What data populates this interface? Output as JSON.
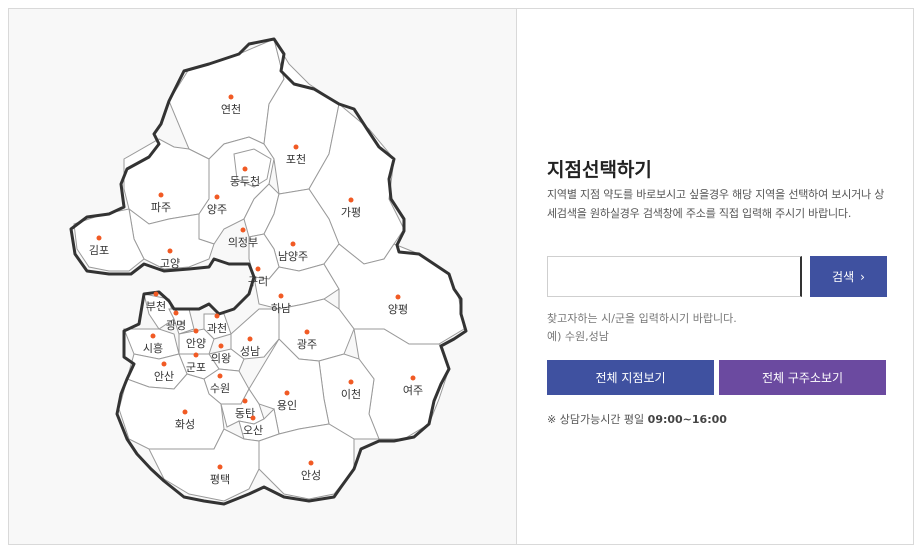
{
  "map": {
    "regions": [
      {
        "name": "연천",
        "id": "yeoncheon"
      },
      {
        "name": "포천",
        "id": "pocheon"
      },
      {
        "name": "동두천",
        "id": "dongducheon"
      },
      {
        "name": "파주",
        "id": "paju"
      },
      {
        "name": "양주",
        "id": "yangju"
      },
      {
        "name": "가평",
        "id": "gapyeong"
      },
      {
        "name": "의정부",
        "id": "uijeongbu"
      },
      {
        "name": "김포",
        "id": "gimpo"
      },
      {
        "name": "남양주",
        "id": "namyangju"
      },
      {
        "name": "고양",
        "id": "goyang"
      },
      {
        "name": "구리",
        "id": "guri"
      },
      {
        "name": "부천",
        "id": "bucheon"
      },
      {
        "name": "하남",
        "id": "hanam"
      },
      {
        "name": "양평",
        "id": "yangpyeong"
      },
      {
        "name": "광명",
        "id": "gwangmyeong"
      },
      {
        "name": "과천",
        "id": "gwacheon"
      },
      {
        "name": "시흥",
        "id": "siheung"
      },
      {
        "name": "안양",
        "id": "anyang"
      },
      {
        "name": "성남",
        "id": "seongnam"
      },
      {
        "name": "광주",
        "id": "gwangju"
      },
      {
        "name": "의왕",
        "id": "uiwang"
      },
      {
        "name": "군포",
        "id": "gunpo"
      },
      {
        "name": "안산",
        "id": "ansan"
      },
      {
        "name": "수원",
        "id": "suwon"
      },
      {
        "name": "여주",
        "id": "yeoju"
      },
      {
        "name": "이천",
        "id": "icheon"
      },
      {
        "name": "용인",
        "id": "yongin"
      },
      {
        "name": "화성",
        "id": "hwaseong"
      },
      {
        "name": "동탄",
        "id": "dongtan"
      },
      {
        "name": "오산",
        "id": "osan"
      },
      {
        "name": "평택",
        "id": "pyeongtaek"
      },
      {
        "name": "안성",
        "id": "anseong"
      }
    ]
  },
  "panel": {
    "title": "지점선택하기",
    "description": "지역별 지점 약도를 바로보시고 싶을경우 해당 지역을 선택하여 보시거나 상세검색을 원하실경우 검색창에 주소를 직접 입력해 주시기 바랍니다.",
    "search": {
      "value": "",
      "placeholder": "",
      "button_label": "검색"
    },
    "hint_line1": "찾고자하는 시/군을 입력하시기 바랍니다.",
    "hint_line2": "예) 수원,성남",
    "all_branches_label": "전체 지점보기",
    "all_rescue_label": "전체 구주소보기",
    "hours_prefix": "※ 상담가능시간 평일",
    "hours_value": "09:00~16:00"
  },
  "colors": {
    "accent_blue": "#3f51a0",
    "accent_purple": "#6b4aa0",
    "dot": "#f15a24"
  }
}
